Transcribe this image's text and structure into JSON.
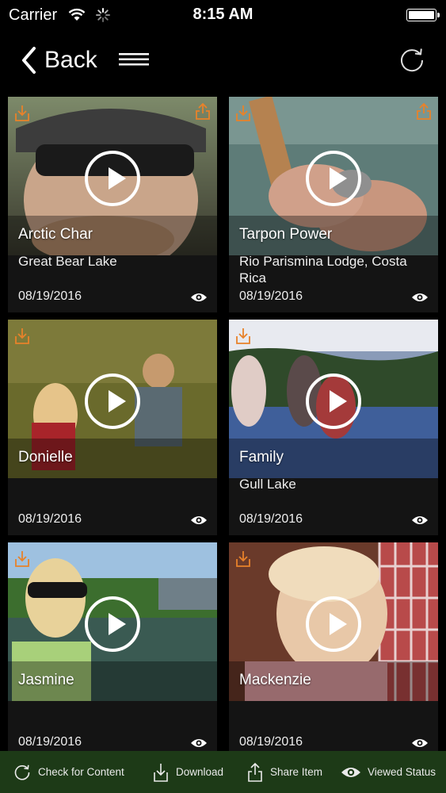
{
  "status": {
    "carrier": "Carrier",
    "time": "8:15 AM"
  },
  "nav": {
    "back_label": "Back"
  },
  "videos": [
    {
      "title": "Arctic Char",
      "location": "Great Bear Lake",
      "date": "08/19/2016"
    },
    {
      "title": "Tarpon Power",
      "location": "Rio Parismina Lodge, Costa Rica",
      "date": "08/19/2016"
    },
    {
      "title": "Donielle",
      "location": "",
      "date": "08/19/2016"
    },
    {
      "title": "Family",
      "location": "Gull Lake",
      "date": "08/19/2016"
    },
    {
      "title": "Jasmine",
      "location": "",
      "date": "08/19/2016"
    },
    {
      "title": "Mackenzie",
      "location": "",
      "date": "08/19/2016"
    }
  ],
  "toolbar": {
    "check_label": "Check for Content",
    "download_label": "Download",
    "share_label": "Share Item",
    "viewed_label": "Viewed Status"
  },
  "colors": {
    "accent": "#e8822a",
    "toolbar_bg": "#1d3a17",
    "background": "#000000"
  }
}
